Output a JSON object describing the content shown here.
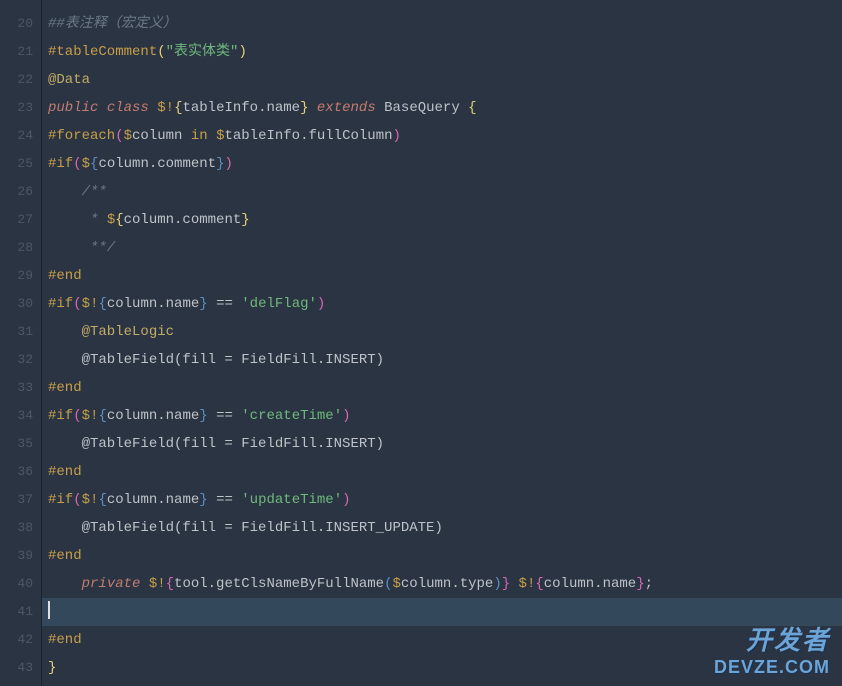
{
  "gutter": {
    "start": 20,
    "end": 43
  },
  "lines": {
    "l20": {
      "segments": [
        {
          "t": "##表注释（宏定义）",
          "c": "comment"
        }
      ]
    },
    "l21": {
      "segments": [
        {
          "t": "#tableComment",
          "c": "directive"
        },
        {
          "t": "(",
          "c": "paren-yellow"
        },
        {
          "t": "\"表实体类\"",
          "c": "string"
        },
        {
          "t": ")",
          "c": "paren-yellow"
        }
      ]
    },
    "l22": {
      "segments": [
        {
          "t": "@Data",
          "c": "annotation"
        }
      ]
    },
    "l23": {
      "segments": [
        {
          "t": "public",
          "c": "keyword-italic"
        },
        {
          "t": " ",
          "c": "var"
        },
        {
          "t": "class",
          "c": "keyword-italic"
        },
        {
          "t": " ",
          "c": "var"
        },
        {
          "t": "$!",
          "c": "directive"
        },
        {
          "t": "{",
          "c": "brace-gold"
        },
        {
          "t": "tableInfo.name",
          "c": "var"
        },
        {
          "t": "}",
          "c": "brace-gold"
        },
        {
          "t": " ",
          "c": "var"
        },
        {
          "t": "extends",
          "c": "keyword-italic"
        },
        {
          "t": " BaseQuery ",
          "c": "var"
        },
        {
          "t": "{",
          "c": "brace-gold"
        }
      ]
    },
    "l24": {
      "segments": [
        {
          "t": "#foreach",
          "c": "directive"
        },
        {
          "t": "(",
          "c": "paren-pink"
        },
        {
          "t": "$",
          "c": "directive"
        },
        {
          "t": "column ",
          "c": "var"
        },
        {
          "t": "in",
          "c": "directive"
        },
        {
          "t": " ",
          "c": "var"
        },
        {
          "t": "$",
          "c": "directive"
        },
        {
          "t": "tableInfo.fullColumn",
          "c": "var"
        },
        {
          "t": ")",
          "c": "paren-pink"
        }
      ]
    },
    "l25": {
      "segments": [
        {
          "t": "#if",
          "c": "directive"
        },
        {
          "t": "(",
          "c": "paren-pink"
        },
        {
          "t": "$",
          "c": "directive"
        },
        {
          "t": "{",
          "c": "bracket-blue"
        },
        {
          "t": "column.comment",
          "c": "var"
        },
        {
          "t": "}",
          "c": "bracket-blue"
        },
        {
          "t": ")",
          "c": "paren-pink"
        }
      ]
    },
    "l26": {
      "segments": [
        {
          "t": "    /**",
          "c": "comment"
        }
      ]
    },
    "l27": {
      "segments": [
        {
          "t": "     * ",
          "c": "comment"
        },
        {
          "t": "$",
          "c": "directive"
        },
        {
          "t": "{",
          "c": "brace-gold"
        },
        {
          "t": "column.comment",
          "c": "var"
        },
        {
          "t": "}",
          "c": "brace-gold"
        }
      ]
    },
    "l28": {
      "segments": [
        {
          "t": "     **/",
          "c": "comment"
        }
      ]
    },
    "l29": {
      "segments": [
        {
          "t": "#end",
          "c": "directive"
        }
      ]
    },
    "l30": {
      "segments": [
        {
          "t": "#if",
          "c": "directive"
        },
        {
          "t": "(",
          "c": "paren-pink"
        },
        {
          "t": "$!",
          "c": "directive"
        },
        {
          "t": "{",
          "c": "bracket-blue"
        },
        {
          "t": "column.name",
          "c": "var"
        },
        {
          "t": "}",
          "c": "bracket-blue"
        },
        {
          "t": " == ",
          "c": "var"
        },
        {
          "t": "'delFlag'",
          "c": "string"
        },
        {
          "t": ")",
          "c": "paren-pink"
        }
      ]
    },
    "l31": {
      "segments": [
        {
          "t": "    @TableLogic",
          "c": "annotation"
        }
      ]
    },
    "l32": {
      "segments": [
        {
          "t": "    @TableField(fill = FieldFill.INSERT)",
          "c": "var"
        }
      ]
    },
    "l33": {
      "segments": [
        {
          "t": "#end",
          "c": "directive"
        }
      ]
    },
    "l34": {
      "segments": [
        {
          "t": "#if",
          "c": "directive"
        },
        {
          "t": "(",
          "c": "paren-pink"
        },
        {
          "t": "$!",
          "c": "directive"
        },
        {
          "t": "{",
          "c": "bracket-blue"
        },
        {
          "t": "column.name",
          "c": "var"
        },
        {
          "t": "}",
          "c": "bracket-blue"
        },
        {
          "t": " == ",
          "c": "var"
        },
        {
          "t": "'createTime'",
          "c": "string"
        },
        {
          "t": ")",
          "c": "paren-pink"
        }
      ]
    },
    "l35": {
      "segments": [
        {
          "t": "    @TableField(fill = FieldFill.INSERT)",
          "c": "var"
        }
      ]
    },
    "l36": {
      "segments": [
        {
          "t": "#end",
          "c": "directive"
        }
      ]
    },
    "l37": {
      "segments": [
        {
          "t": "#if",
          "c": "directive"
        },
        {
          "t": "(",
          "c": "paren-pink"
        },
        {
          "t": "$!",
          "c": "directive"
        },
        {
          "t": "{",
          "c": "bracket-blue"
        },
        {
          "t": "column.name",
          "c": "var"
        },
        {
          "t": "}",
          "c": "bracket-blue"
        },
        {
          "t": " == ",
          "c": "var"
        },
        {
          "t": "'updateTime'",
          "c": "string"
        },
        {
          "t": ")",
          "c": "paren-pink"
        }
      ]
    },
    "l38": {
      "segments": [
        {
          "t": "    @TableField(fill = FieldFill.INSERT_UPDATE)",
          "c": "var"
        }
      ]
    },
    "l39": {
      "segments": [
        {
          "t": "#end",
          "c": "directive"
        }
      ]
    },
    "l40": {
      "segments": [
        {
          "t": "    ",
          "c": "var"
        },
        {
          "t": "private",
          "c": "keyword-italic"
        },
        {
          "t": " ",
          "c": "var"
        },
        {
          "t": "$!",
          "c": "directive"
        },
        {
          "t": "{",
          "c": "paren-pink"
        },
        {
          "t": "tool.getClsNameByFullName",
          "c": "var"
        },
        {
          "t": "(",
          "c": "bracket-blue"
        },
        {
          "t": "$",
          "c": "directive"
        },
        {
          "t": "column.type",
          "c": "var"
        },
        {
          "t": ")",
          "c": "bracket-blue"
        },
        {
          "t": "}",
          "c": "paren-pink"
        },
        {
          "t": " ",
          "c": "var"
        },
        {
          "t": "$!",
          "c": "directive"
        },
        {
          "t": "{",
          "c": "paren-pink"
        },
        {
          "t": "column.name",
          "c": "var"
        },
        {
          "t": "}",
          "c": "paren-pink"
        },
        {
          "t": ";",
          "c": "var"
        }
      ]
    },
    "l41": {
      "highlighted": true,
      "cursor": true,
      "segments": []
    },
    "l42": {
      "segments": [
        {
          "t": "#end",
          "c": "directive"
        }
      ]
    },
    "l43": {
      "segments": [
        {
          "t": "}",
          "c": "brace-gold"
        }
      ]
    }
  },
  "watermark": {
    "line1": "开发者",
    "line2": "DEVZE.COM"
  }
}
